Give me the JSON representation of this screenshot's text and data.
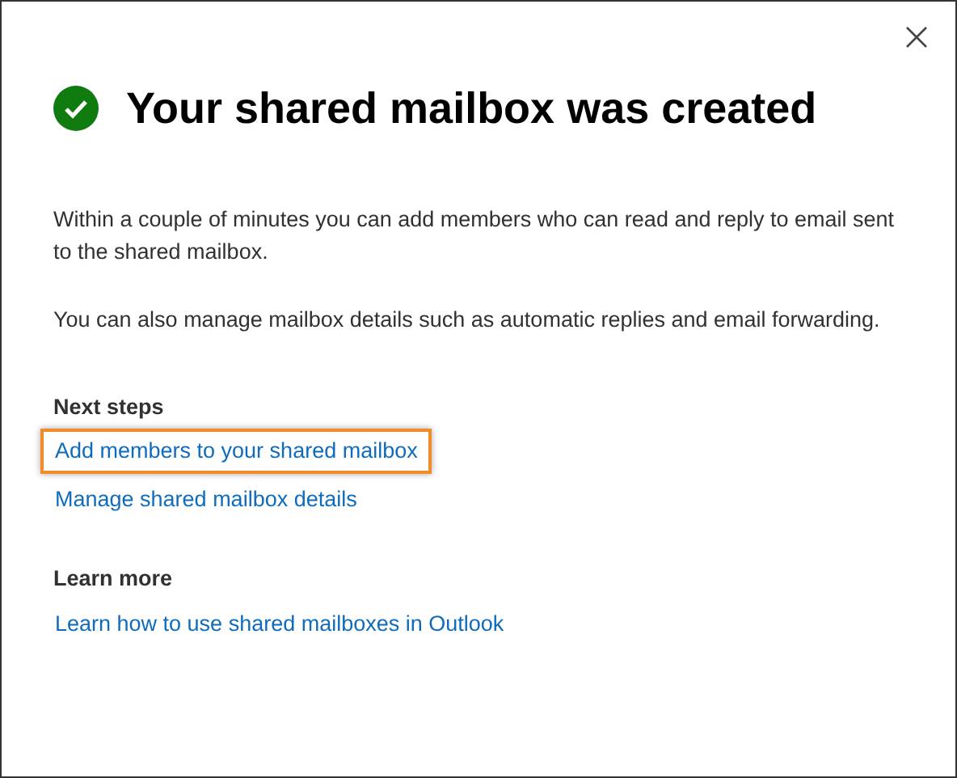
{
  "dialog": {
    "title": "Your shared mailbox was created",
    "paragraphs": [
      "Within a couple of minutes you can add members who can read and reply to email sent to the shared mailbox.",
      "You can also manage mailbox details such as automatic replies and email forwarding."
    ],
    "sections": [
      {
        "heading": "Next steps",
        "links": [
          {
            "label": "Add members to your shared mailbox",
            "highlighted": true
          },
          {
            "label": "Manage shared mailbox details",
            "highlighted": false
          }
        ]
      },
      {
        "heading": "Learn more",
        "links": [
          {
            "label": "Learn how to use shared mailboxes in Outlook",
            "highlighted": false
          }
        ]
      }
    ]
  }
}
